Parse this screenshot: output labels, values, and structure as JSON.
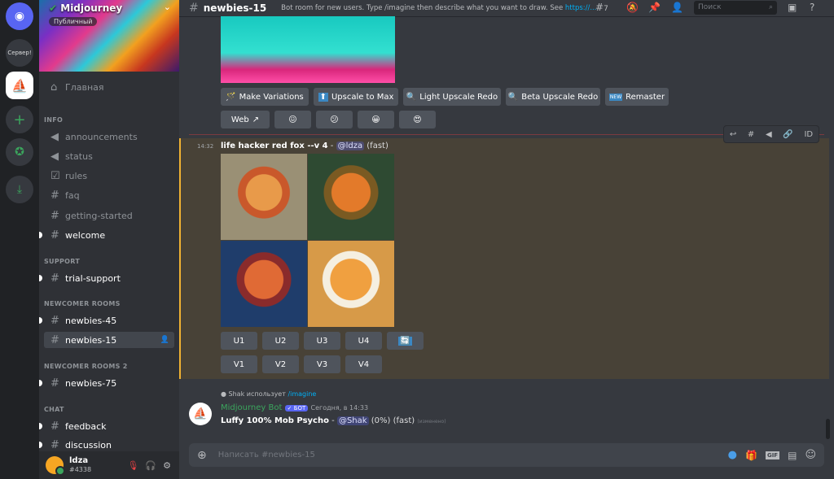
{
  "servers": {
    "home_label": "Discord",
    "server1": "Сервер!",
    "midjourney": "Midjourney"
  },
  "guild": {
    "name": "Midjourney",
    "badge": "Публичный",
    "home": "Главная"
  },
  "categories": [
    "INFO",
    "SUPPORT",
    "NEWCOMER ROOMS",
    "NEWCOMER ROOMS 2",
    "CHAT"
  ],
  "channels": [
    {
      "name": "announcements",
      "icon": "megaphone"
    },
    {
      "name": "status",
      "icon": "megaphone"
    },
    {
      "name": "rules",
      "icon": "checkbox"
    },
    {
      "name": "faq",
      "icon": "hash"
    },
    {
      "name": "getting-started",
      "icon": "hash"
    },
    {
      "name": "welcome",
      "icon": "hash"
    },
    {
      "name": "trial-support",
      "icon": "hash"
    },
    {
      "name": "newbies-45",
      "icon": "hash-thread"
    },
    {
      "name": "newbies-15",
      "icon": "hash-thread"
    },
    {
      "name": "newbies-75",
      "icon": "hash-thread"
    },
    {
      "name": "feedback",
      "icon": "hash-thread"
    },
    {
      "name": "discussion",
      "icon": "hash-thread"
    }
  ],
  "user": {
    "name": "ldza",
    "tag": "#4338"
  },
  "header": {
    "channel": "newbies-15",
    "topic": "Bot room for new users. Type /imagine then describe what you want to draw. See ",
    "link": "https://...",
    "threads": "7",
    "search_placeholder": "Поиск"
  },
  "actions": {
    "buttons": [
      "Make Variations",
      "Upscale to Max",
      "Light Upscale Redo",
      "Beta Upscale Redo",
      "Remaster"
    ],
    "web": "Web"
  },
  "message": {
    "time": "14:32",
    "prompt": "life hacker red fox --v 4",
    "sep": " - ",
    "mention": "@ldza",
    "mode": "(fast)",
    "upscale": [
      "U1",
      "U2",
      "U3",
      "U4"
    ],
    "variation": [
      "V1",
      "V2",
      "V3",
      "V4"
    ]
  },
  "reply": {
    "user": "Shak",
    "uses": "использует",
    "command": "/imagine",
    "author": "Midjourney Bot",
    "bot": "✓ БОТ",
    "timestamp": "Сегодня, в 14:33",
    "prompt": "Luffy 100% Mob Psycho",
    "mention": "@Shak",
    "progress": "(0%)",
    "mode": "(fast)",
    "edited": "(изменено)"
  },
  "composer": {
    "placeholder": "Написать #newbies-15",
    "gif": "GIF"
  },
  "colors": {
    "accent": "#5865f2",
    "highlight": "#f0b232",
    "bot_name": "#3ba55d"
  }
}
